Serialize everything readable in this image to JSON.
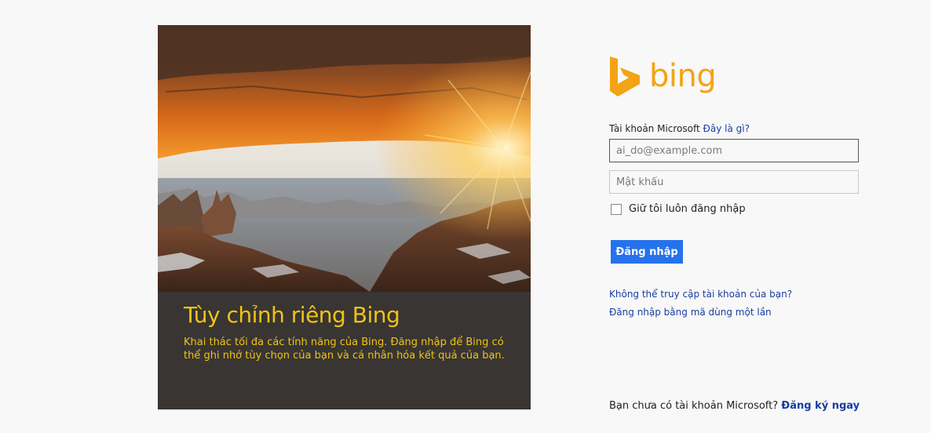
{
  "promo": {
    "title": "Tùy chỉnh riêng Bing",
    "description": "Khai thác tối đa các tính năng của Bing. Đăng nhập để Bing có thể ghi nhớ tùy chọn của bạn và cá nhân hóa kết quả của bạn."
  },
  "logo": {
    "text": "bing"
  },
  "form": {
    "account_label": "Tài khoản Microsoft",
    "what_is_link": "Đây là gì?",
    "email_placeholder": "ai_do@example.com",
    "password_placeholder": "Mật khẩu",
    "remember_label": "Giữ tôi luôn đăng nhập",
    "remember_checked": false,
    "signin_button": "Đăng nhập"
  },
  "links": {
    "cant_access": "Không thể truy cập tài khoản của bạn?",
    "one_time_code": "Đăng nhập bằng mã dùng một lần"
  },
  "signup": {
    "prompt": "Bạn chưa có tài khoản Microsoft?",
    "link": "Đăng ký ngay"
  },
  "colors": {
    "brand_orange": "#f4a314",
    "promo_yellow": "#f2c314",
    "button_blue": "#2672ec",
    "link_blue": "#1a3da0",
    "panel_bg": "#383533"
  }
}
